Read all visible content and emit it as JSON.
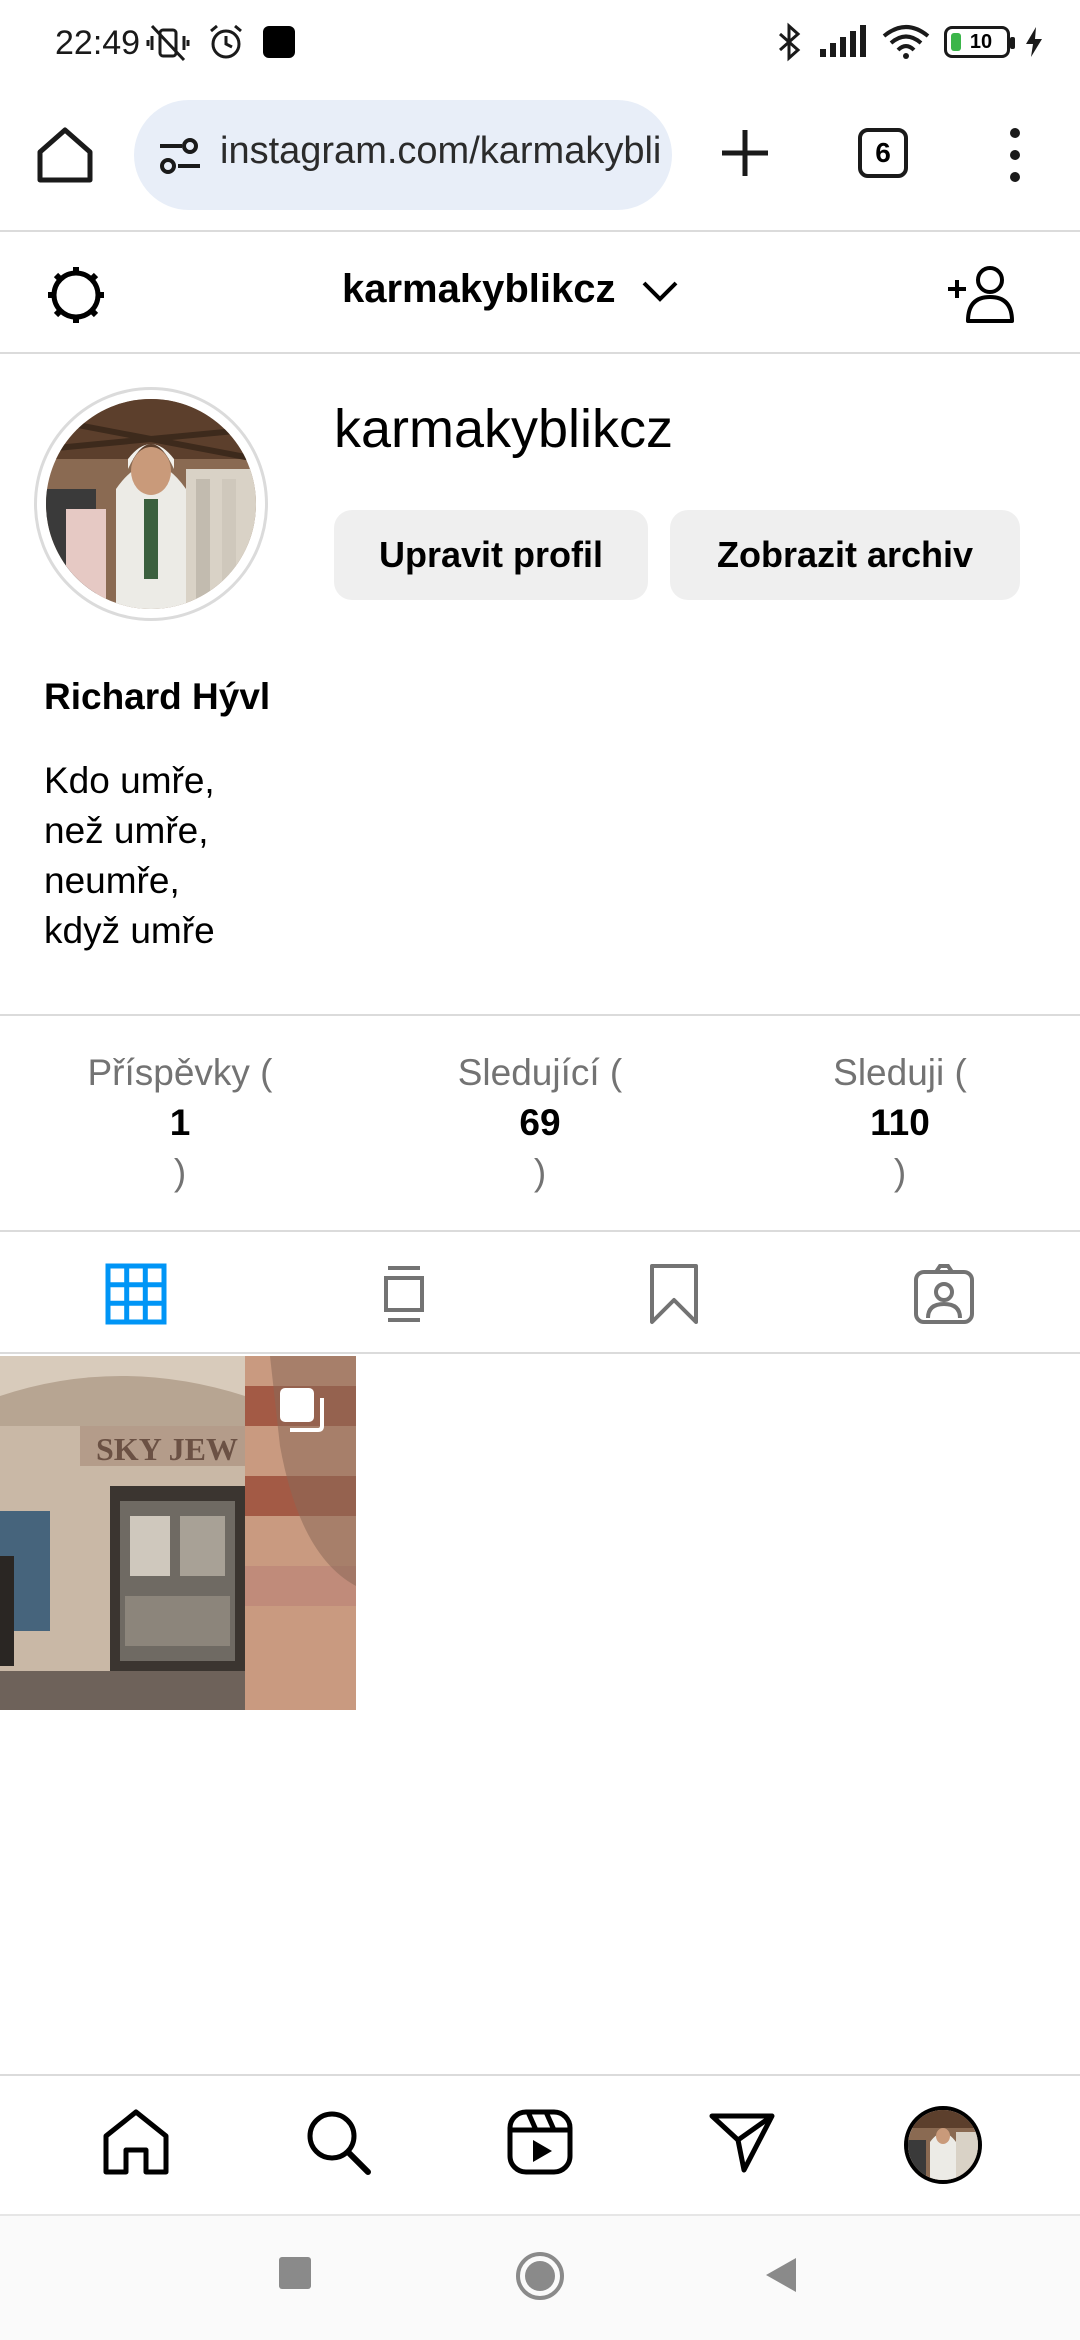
{
  "status_bar": {
    "time": "22:49",
    "battery_level": "10",
    "icons": [
      "mute-vibrate-icon",
      "alarm-icon",
      "notification-square-icon",
      "bluetooth-icon",
      "signal-icon",
      "wifi-icon",
      "battery-icon",
      "charging-icon"
    ]
  },
  "browser": {
    "url": "instagram.com/karmakyblikcz",
    "tab_count": "6",
    "icons": [
      "home-icon",
      "site-settings-icon",
      "new-tab-plus-icon",
      "tabs-icon",
      "more-vert-icon"
    ]
  },
  "instagram_header": {
    "username": "karmakyblikcz",
    "icons": [
      "settings-icon",
      "chevron-down-icon",
      "add-user-icon"
    ]
  },
  "profile": {
    "username": "karmakyblikcz",
    "edit_button": "Upravit profil",
    "archive_button": "Zobrazit archiv",
    "full_name": "Richard Hývl",
    "bio": [
      "Kdo umře,",
      "než umře,",
      "neumře,",
      "když umře"
    ]
  },
  "stats": [
    {
      "label": "Příspěvky (",
      "value": "1",
      "close": ")"
    },
    {
      "label": "Sledující (",
      "value": "69",
      "close": ")"
    },
    {
      "label": "Sleduji (",
      "value": "110",
      "close": ")"
    }
  ],
  "tabs": [
    {
      "name": "grid-icon",
      "active": true
    },
    {
      "name": "feed-icon",
      "active": false
    },
    {
      "name": "saved-icon",
      "active": false
    },
    {
      "name": "tagged-icon",
      "active": false
    }
  ],
  "posts": [
    {
      "type": "carousel",
      "sign_text": "SKY JEW"
    }
  ],
  "bottom_nav": [
    "home-icon",
    "search-icon",
    "reels-icon",
    "direct-icon",
    "profile-avatar"
  ],
  "colors": {
    "accent_blue": "#0095f6",
    "button_bg": "#efefef",
    "secondary_text": "#737373",
    "url_bar_bg": "#e8eef8"
  }
}
